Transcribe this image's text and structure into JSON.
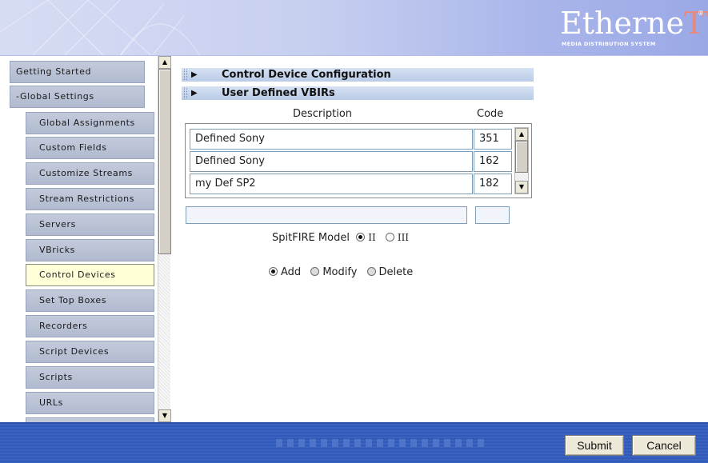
{
  "header": {
    "logo_brand": "Etherne",
    "logo_brand_tv": "TV",
    "logo_reg": "®",
    "logo_tagline": "MEDIA DISTRIBUTION SYSTEM"
  },
  "sidebar": {
    "items": [
      {
        "label": "Getting Started",
        "level": "top",
        "active": false
      },
      {
        "label": "-Global Settings",
        "level": "top",
        "active": false
      },
      {
        "label": "Global Assignments",
        "level": "sub",
        "active": false
      },
      {
        "label": "Custom Fields",
        "level": "sub",
        "active": false
      },
      {
        "label": "Customize Streams",
        "level": "sub",
        "active": false
      },
      {
        "label": "Stream Restrictions",
        "level": "sub",
        "active": false
      },
      {
        "label": "Servers",
        "level": "sub",
        "active": false
      },
      {
        "label": "VBricks",
        "level": "sub",
        "active": false
      },
      {
        "label": "Control Devices",
        "level": "sub",
        "active": true
      },
      {
        "label": "Set Top Boxes",
        "level": "sub",
        "active": false
      },
      {
        "label": "Recorders",
        "level": "sub",
        "active": false
      },
      {
        "label": "Script Devices",
        "level": "sub",
        "active": false
      },
      {
        "label": "Scripts",
        "level": "sub",
        "active": false
      },
      {
        "label": "URLs",
        "level": "sub",
        "active": false
      },
      {
        "label": "",
        "level": "sub",
        "active": false
      }
    ],
    "scroll_up_arrow": "▲",
    "scroll_down_arrow": "▼"
  },
  "main": {
    "sections": [
      {
        "title": "Control Device Configuration",
        "arrow": "▶"
      },
      {
        "title": "User Defined VBIRs",
        "arrow": "▶"
      }
    ],
    "table": {
      "columns": {
        "description": "Description",
        "code": "Code"
      },
      "rows": [
        {
          "description": "Defined Sony",
          "code": "351"
        },
        {
          "description": "Defined Sony",
          "code": "162"
        },
        {
          "description": "my Def SP2",
          "code": "182"
        }
      ],
      "scroll_up_arrow": "▲",
      "scroll_down_arrow": "▼"
    },
    "new_description_value": "",
    "new_code_value": "",
    "model": {
      "label": "SpitFIRE Model",
      "options": [
        {
          "label": "II",
          "selected": true
        },
        {
          "label": "III",
          "selected": false
        }
      ]
    },
    "actions": {
      "options": [
        {
          "label": "Add",
          "selected": true
        },
        {
          "label": "Modify",
          "selected": false
        },
        {
          "label": "Delete",
          "selected": false
        }
      ]
    }
  },
  "footer": {
    "submit_label": "Submit",
    "cancel_label": "Cancel"
  },
  "colors": {
    "header_gradient_start": "#d6dcf3",
    "header_gradient_end": "#9aa8e6",
    "logo_tv_accent": "#e58a80",
    "nav_button": "#b8c0d3",
    "nav_active": "#ffffd8",
    "section_bar": "#c7d6ee",
    "footer_blue": "#3a64c2"
  }
}
